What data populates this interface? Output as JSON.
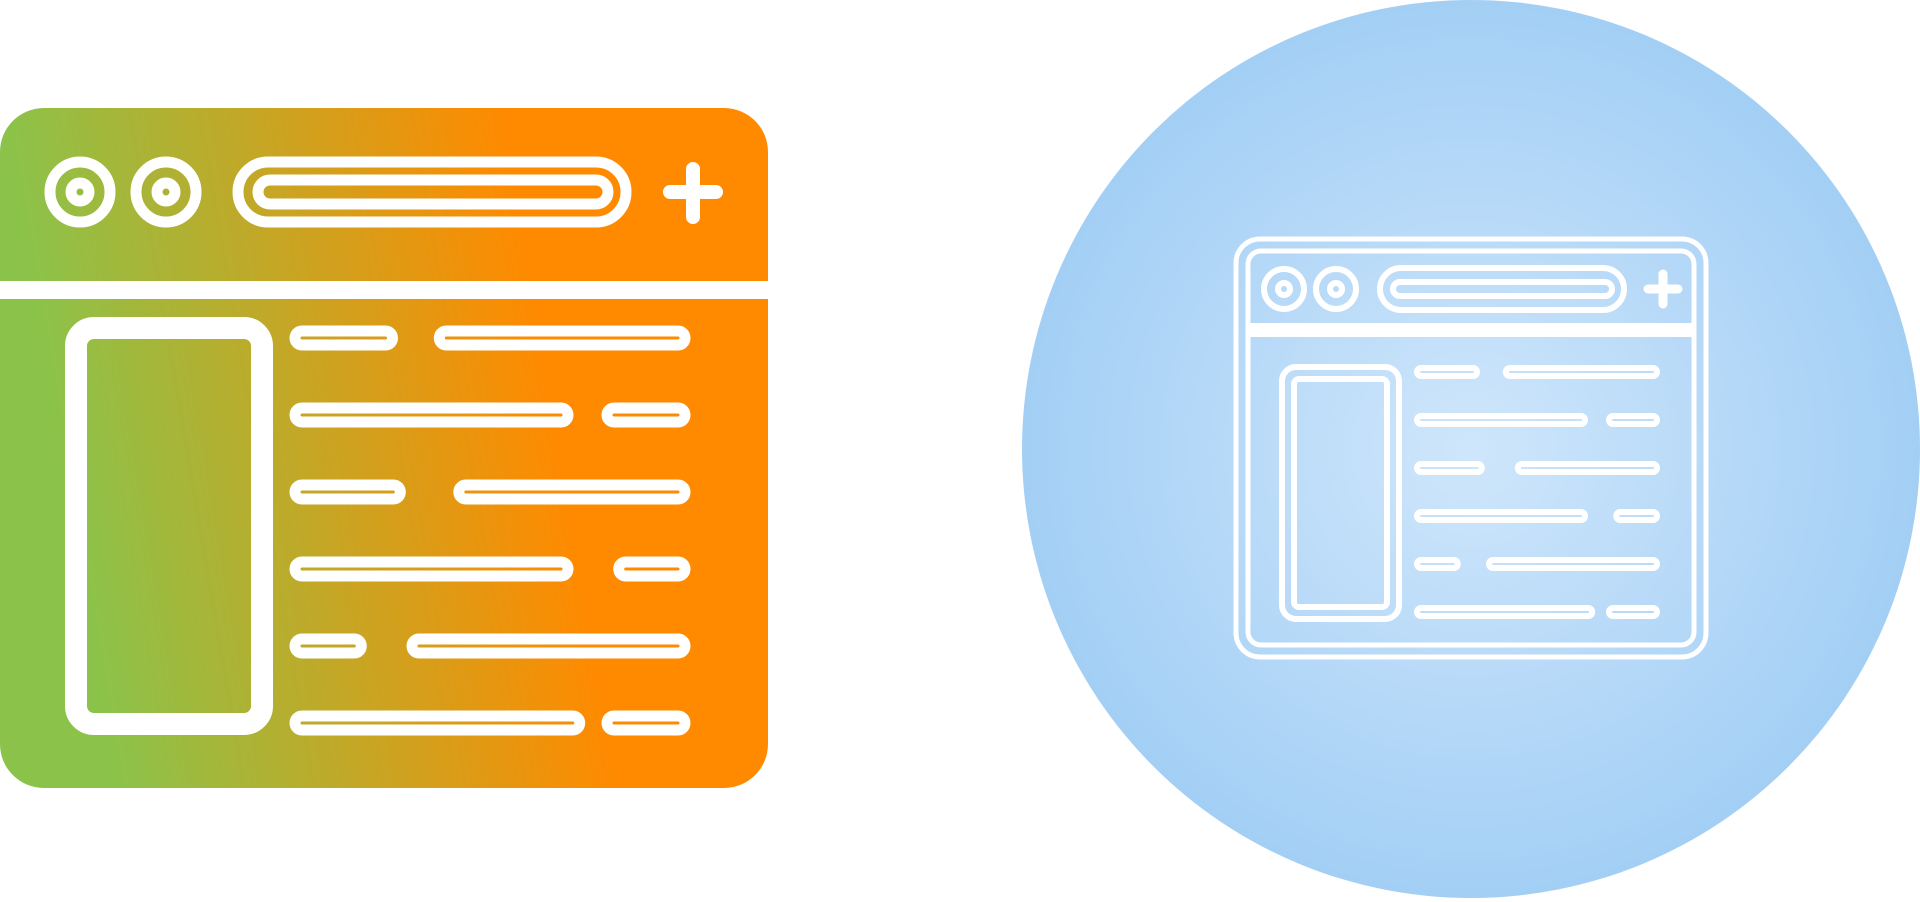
{
  "icons": [
    {
      "name": "browser-window-icon",
      "variant": "glyph-gradient",
      "colors": {
        "gradient_start": "#8bc34a",
        "gradient_end": "#ff8a00",
        "stroke": "#ffffff"
      }
    },
    {
      "name": "browser-window-icon",
      "variant": "outline-circle",
      "colors": {
        "circle_center": "#cfe6fb",
        "circle_edge": "#a3cff5",
        "stroke": "#ffffff"
      }
    }
  ],
  "content_rows": [
    {
      "short_first": true,
      "short_frac": 0.25,
      "gap_frac": 0.12
    },
    {
      "short_first": false,
      "short_frac": 0.2,
      "gap_frac": 0.1
    },
    {
      "short_first": true,
      "short_frac": 0.27,
      "gap_frac": 0.15
    },
    {
      "short_first": false,
      "short_frac": 0.17,
      "gap_frac": 0.13
    },
    {
      "short_first": true,
      "short_frac": 0.17,
      "gap_frac": 0.13
    },
    {
      "short_first": false,
      "short_frac": 0.2,
      "gap_frac": 0.07
    }
  ]
}
